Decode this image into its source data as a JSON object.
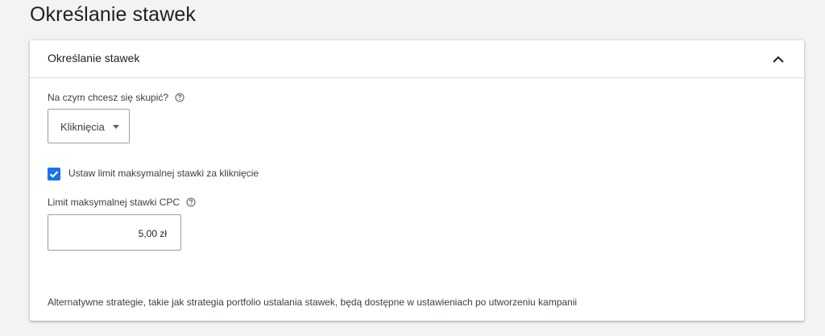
{
  "page": {
    "title": "Określanie stawek"
  },
  "card": {
    "title": "Określanie stawek",
    "collapse_icon": "chevron-up-icon",
    "focus": {
      "label": "Na czym chcesz się skupić?",
      "help_icon": "help-circle-icon",
      "selected": "Kliknięcia"
    },
    "limit_checkbox": {
      "checked": true,
      "label": "Ustaw limit maksymalnej stawki za kliknięcie"
    },
    "max_cpc": {
      "label": "Limit maksymalnej stawki CPC",
      "help_icon": "help-circle-icon",
      "value": "5,00 zł"
    },
    "footnote": "Alternatywne strategie, takie jak strategia portfolio ustalania stawek, będą dostępne w ustawieniach po utworzeniu kampanii"
  },
  "colors": {
    "accent": "#1a73e8",
    "background": "#f1f3f4",
    "border": "#dadce0"
  }
}
